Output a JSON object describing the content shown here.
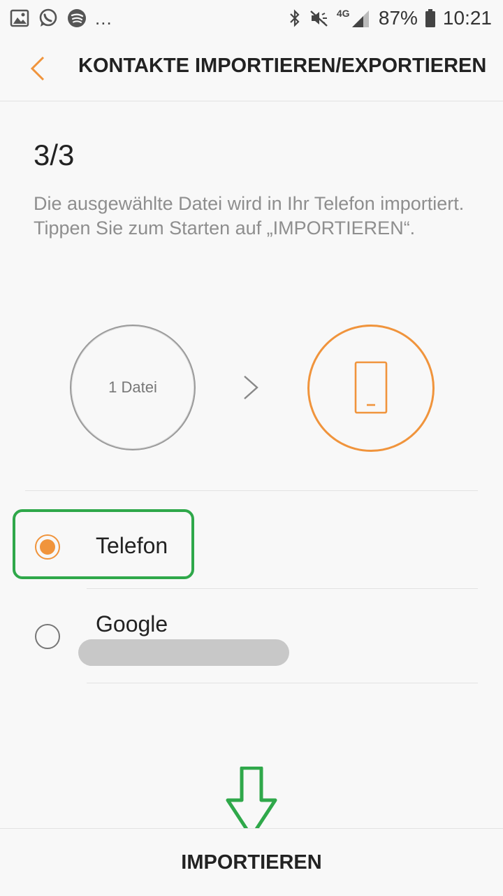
{
  "status_bar": {
    "left_icons": [
      "gallery-icon",
      "whatsapp-icon",
      "spotify-icon"
    ],
    "overflow": "...",
    "network": "4G",
    "battery": "87%",
    "time": "10:21"
  },
  "header": {
    "title": "KONTAKTE IMPORTIEREN/EXPORTIEREN"
  },
  "step": "3/3",
  "description": "Die ausgewählte Datei wird in Ihr Telefon importiert. Tippen Sie zum Starten auf „IMPORTIEREN“.",
  "source": {
    "label": "1 Datei"
  },
  "destination": {
    "icon": "phone-icon"
  },
  "options": [
    {
      "label": "Telefon",
      "selected": true
    },
    {
      "label": "Google",
      "selected": false
    }
  ],
  "action": {
    "label": "IMPORTIEREN"
  },
  "colors": {
    "accent": "#f0943c",
    "highlight": "#2fa84a"
  }
}
